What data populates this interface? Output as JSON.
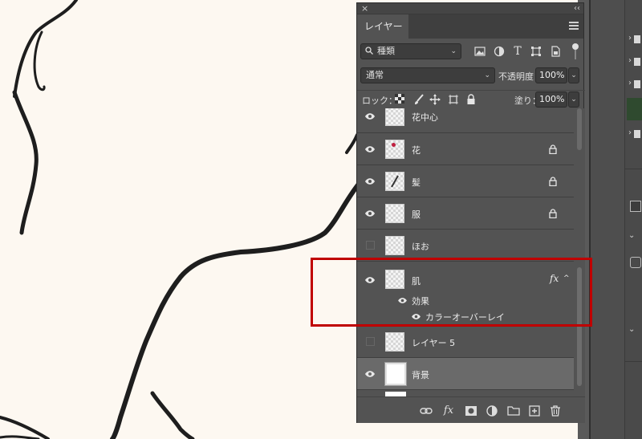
{
  "panel": {
    "close_glyph": "×",
    "collapse_glyph": "‹‹",
    "tab_label": "レイヤー",
    "filter": {
      "value": "種類"
    },
    "blend_mode": "通常",
    "opacity_label": "不透明度：",
    "opacity_value": "100%",
    "lock_label": "ロック：",
    "fill_label": "塗り：",
    "fill_value": "100%"
  },
  "layers": [
    {
      "name": "花中心",
      "visible": true,
      "locked": false
    },
    {
      "name": "花",
      "visible": true,
      "locked": true
    },
    {
      "name": "髪",
      "visible": true,
      "locked": true
    },
    {
      "name": "服",
      "visible": true,
      "locked": true
    },
    {
      "name": "ほお",
      "visible": false,
      "locked": false
    },
    {
      "name": "肌",
      "visible": true,
      "locked": false,
      "fx": "fx",
      "effects_label": "効果",
      "effect_name": "カラーオーバーレイ"
    },
    {
      "name": "レイヤー 5",
      "visible": false,
      "locked": false
    },
    {
      "name": "背景",
      "visible": true,
      "locked": false,
      "selected": true
    }
  ],
  "bottom_bar": {
    "fx_label": "fx"
  },
  "colors": {
    "panel_bg": "#535353",
    "selected_row": "#6a6a6a",
    "highlight": "#c00000",
    "canvas": "#fdf8f1"
  },
  "icons": [
    "search-icon",
    "pixel-filter-icon",
    "adjustment-filter-icon",
    "type-filter-icon",
    "shape-filter-icon",
    "smart-object-filter-icon",
    "lock-transparent-icon",
    "lock-paint-icon",
    "lock-move-icon",
    "lock-artboard-icon",
    "lock-all-icon",
    "eye-icon",
    "lock-icon",
    "link-icon",
    "fx-icon",
    "mask-icon",
    "adjustment-icon",
    "folder-icon",
    "new-layer-icon",
    "trash-icon"
  ]
}
